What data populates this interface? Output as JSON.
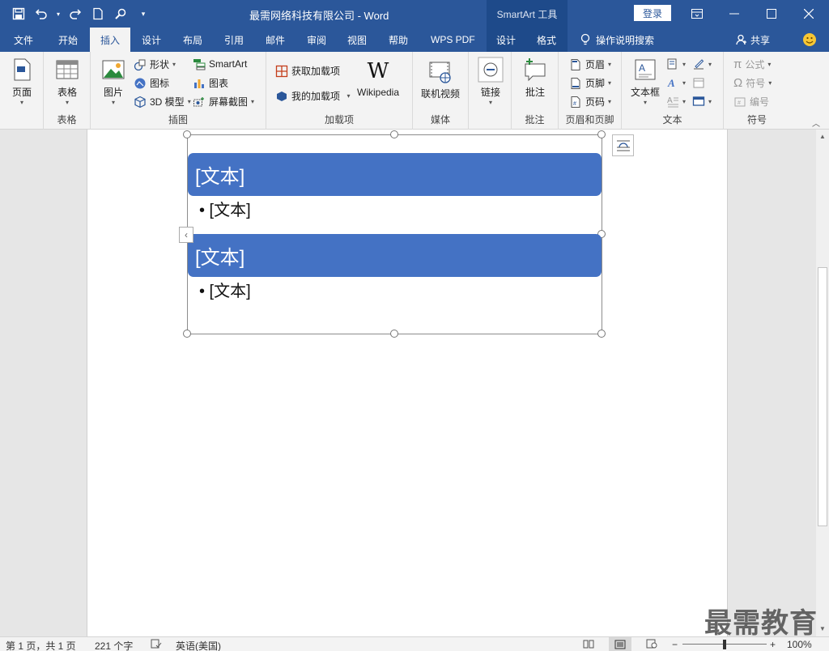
{
  "titlebar": {
    "title": "最需网络科技有限公司  -  Word",
    "smartart_tools": "SmartArt 工具",
    "login": "登录"
  },
  "tabs": {
    "file": "文件",
    "home": "开始",
    "insert": "插入",
    "design": "设计",
    "layout": "布局",
    "references": "引用",
    "mailings": "邮件",
    "review": "审阅",
    "view": "视图",
    "help": "帮助",
    "wps_pdf": "WPS PDF",
    "sa_design": "设计",
    "sa_format": "格式",
    "tell_me": "操作说明搜索",
    "share": "共享"
  },
  "ribbon": {
    "pages": {
      "btn": "页面"
    },
    "tables": {
      "btn": "表格",
      "group": "表格"
    },
    "illustrations": {
      "pictures": "图片",
      "shapes": "形状",
      "icons": "图标",
      "models3d": "3D 模型",
      "smartart": "SmartArt",
      "chart": "图表",
      "screenshot": "屏幕截图",
      "group": "插图"
    },
    "addins": {
      "get": "获取加载项",
      "my": "我的加载项",
      "wikipedia": "Wikipedia",
      "group": "加载项"
    },
    "media": {
      "online_video": "联机视频",
      "group": "媒体"
    },
    "links": {
      "btn": "链接"
    },
    "comments": {
      "btn": "批注",
      "group": "批注"
    },
    "header_footer": {
      "header": "页眉",
      "footer": "页脚",
      "page_number": "页码",
      "group": "页眉和页脚"
    },
    "text": {
      "textbox": "文本框",
      "group": "文本"
    },
    "symbols": {
      "equation": "公式",
      "symbol": "符号",
      "numbering": "编号",
      "group": "符号"
    }
  },
  "smartart": {
    "header1": "[文本]",
    "bullet1": "• [文本]",
    "header2": "[文本]",
    "bullet2": "• [文本]",
    "accent": "#4472c4"
  },
  "status": {
    "page": "第 1 页，共 1 页",
    "words": "221 个字",
    "language": "英语(美国)",
    "zoom": "100%"
  },
  "watermark": "最需教育"
}
